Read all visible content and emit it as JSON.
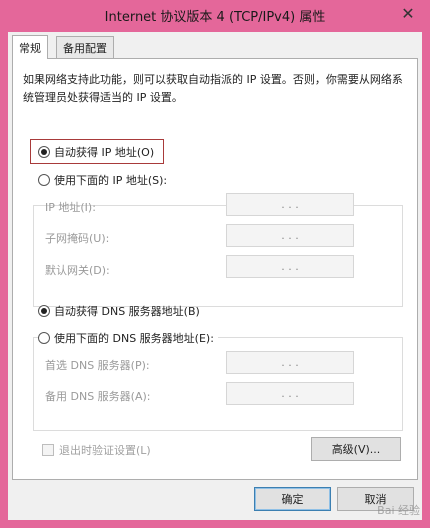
{
  "window": {
    "title": "Internet 协议版本 4 (TCP/IPv4) 属性",
    "close_glyph": "✕",
    "frame_color": "#e4679a"
  },
  "tabs": [
    {
      "label": "常规",
      "active": true
    },
    {
      "label": "备用配置",
      "active": false
    }
  ],
  "description": "如果网络支持此功能，则可以获取自动指派的 IP 设置。否则，你需要从网络系统管理员处获得适当的 IP 设置。",
  "ip_section": {
    "auto_label": "自动获得 IP 地址(O)",
    "auto_selected": true,
    "manual_label": "使用下面的 IP 地址(S):",
    "manual_selected": false,
    "fields": [
      {
        "label": "IP 地址(I):",
        "value": ". . ."
      },
      {
        "label": "子网掩码(U):",
        "value": ". . ."
      },
      {
        "label": "默认网关(D):",
        "value": ". . ."
      }
    ]
  },
  "dns_section": {
    "auto_label": "自动获得 DNS 服务器地址(B)",
    "auto_selected": true,
    "manual_label": "使用下面的 DNS 服务器地址(E):",
    "manual_selected": false,
    "fields": [
      {
        "label": "首选 DNS 服务器(P):",
        "value": ". . ."
      },
      {
        "label": "备用 DNS 服务器(A):",
        "value": ". . ."
      }
    ]
  },
  "validate_checkbox": {
    "label": "退出时验证设置(L)",
    "checked": false,
    "enabled": false
  },
  "buttons": {
    "advanced": "高级(V)...",
    "ok": "确定",
    "cancel": "取消"
  },
  "watermark": "Bai 经验"
}
